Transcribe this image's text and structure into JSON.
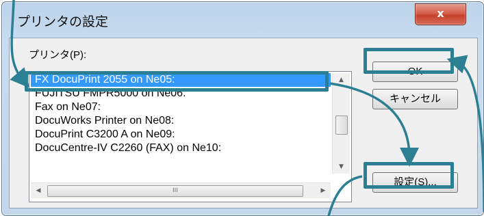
{
  "window": {
    "title": "プリンタの設定",
    "close_label": "x"
  },
  "printer_group": {
    "label": "プリンタ(P):"
  },
  "printer_list": {
    "items": [
      "FX DocuPrint 2055 on Ne05:",
      "FUJITSU FMPR5000 on Ne06:",
      "Fax on Ne07:",
      "DocuWorks Printer on Ne08:",
      "DocuPrint C3200 A on Ne09:",
      "DocuCentre-IV C2260 (FAX) on Ne10:"
    ],
    "selected_index": 0,
    "hscroll_grip": "III"
  },
  "buttons": {
    "ok": "OK",
    "cancel": "キャンセル",
    "setup": "設定(S)..."
  },
  "colors": {
    "highlight": "#2c7f92",
    "selection": "#3399ff"
  }
}
